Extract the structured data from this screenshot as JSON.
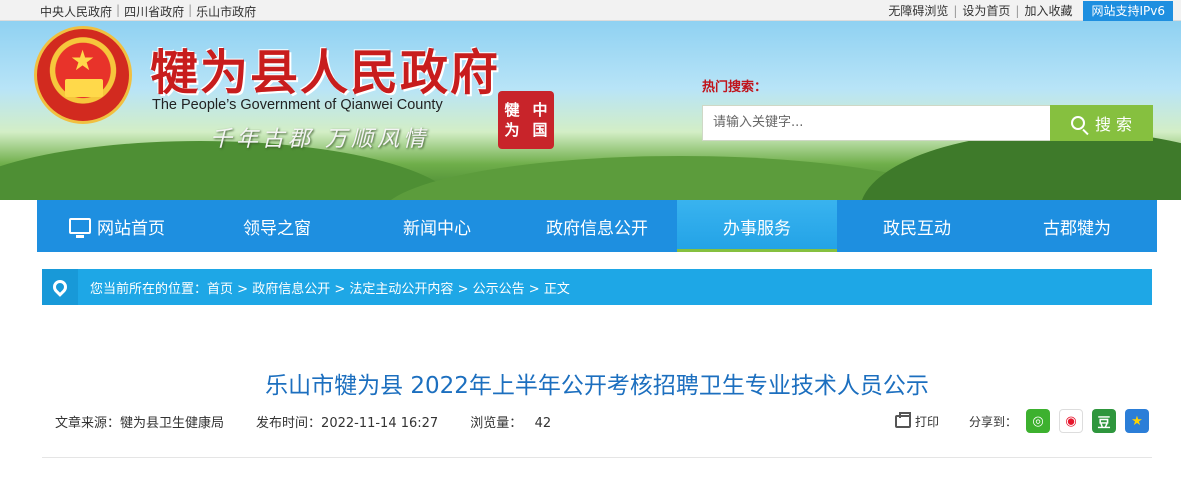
{
  "topbar": {
    "left_links": [
      "中央人民政府",
      "四川省政府",
      "乐山市政府"
    ],
    "right_links": [
      "无障碍浏览",
      "设为首页",
      "加入收藏"
    ],
    "ipv6_badge": "网站支持IPv6"
  },
  "banner": {
    "title_cn": "犍为县人民政府",
    "title_en": "The People’s Government of Qianwei County",
    "slogan": "千年古郡 万顺风情",
    "seal_chars": [
      "犍",
      "中",
      "为",
      "国"
    ],
    "hot_search_label": "热门搜索：",
    "search_placeholder": "请输入关键字...",
    "search_button": "搜 索"
  },
  "nav": {
    "items": [
      "网站首页",
      "领导之窗",
      "新闻中心",
      "政府信息公开",
      "办事服务",
      "政民互动",
      "古郡犍为"
    ],
    "active_index": 4
  },
  "breadcrumb": {
    "prefix": "您当前所在的位置：",
    "items": [
      "首页",
      "政府信息公开",
      "法定主动公开内容",
      "公示公告",
      "正文"
    ],
    "separator": ">"
  },
  "article": {
    "title": "乐山市犍为县 2022年上半年公开考核招聘卫生专业技术人员公示",
    "source_label": "文章来源：",
    "source": "犍为县卫生健康局",
    "publish_label": "发布时间：",
    "publish_time": "2022-11-14 16:27",
    "views_label": "浏览量：",
    "views": "42",
    "print_label": "打印",
    "share_label": "分享到："
  },
  "colors": {
    "nav_blue": "#1e8fe0",
    "breadcrumb_blue": "#1ea7e6",
    "accent_green": "#86c03f",
    "title_red": "#c81d1d",
    "article_title_blue": "#1c6fbf"
  }
}
